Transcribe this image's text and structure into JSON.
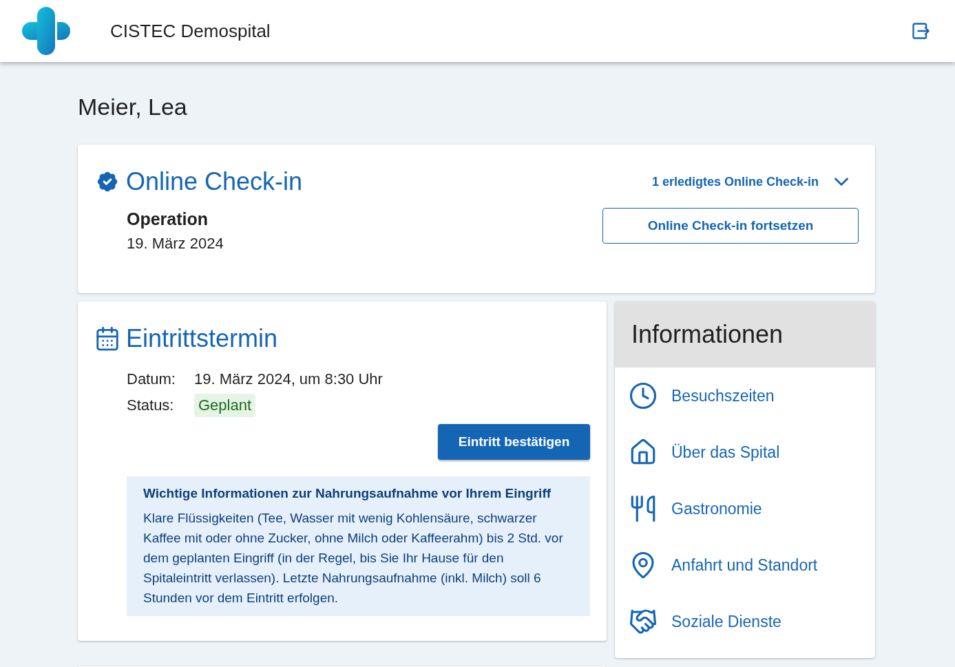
{
  "header": {
    "title": "CISTEC Demospital"
  },
  "patient": {
    "name": "Meier, Lea"
  },
  "checkin": {
    "title": "Online Check-in",
    "completed_toggle": "1 erledigtes Online Check-in",
    "expanded": false,
    "procedure": "Operation",
    "date": "19. März 2024",
    "button": "Online Check-in fortsetzen"
  },
  "admission": {
    "title": "Eintrittstermin",
    "fields": [
      {
        "label": "Datum:",
        "value": "19. März 2024, um 8:30 Uhr",
        "kind": "text"
      },
      {
        "label": "Status:",
        "value": "Geplant",
        "kind": "tag"
      }
    ],
    "button": "Eintritt bestätigen",
    "notice": {
      "title": "Wichtige Informationen zur Nahrungsaufnahme vor Ihrem Eingriff",
      "body": "Klare Flüssigkeiten (Tee, Wasser mit wenig Kohlensäure, schwarzer Kaffee mit oder ohne Zucker, ohne Milch oder Kaffeerahm) bis 2 Std. vor dem geplanten Eingriff (in der Regel, bis Sie Ihr Hause für den Spitaleintritt verlassen). Letzte Nahrungsaufnahme (inkl. Milch) soll 6 Stunden vor dem Eintritt erfolgen."
    }
  },
  "info": {
    "title": "Informationen",
    "items": [
      {
        "label": "Besuchszeiten",
        "kind": "clock"
      },
      {
        "label": "Über das Spital",
        "kind": "house"
      },
      {
        "label": "Gastronomie",
        "kind": "food"
      },
      {
        "label": "Anfahrt und Standort",
        "kind": "location"
      },
      {
        "label": "Soziale Dienste",
        "kind": "handshake"
      }
    ]
  }
}
